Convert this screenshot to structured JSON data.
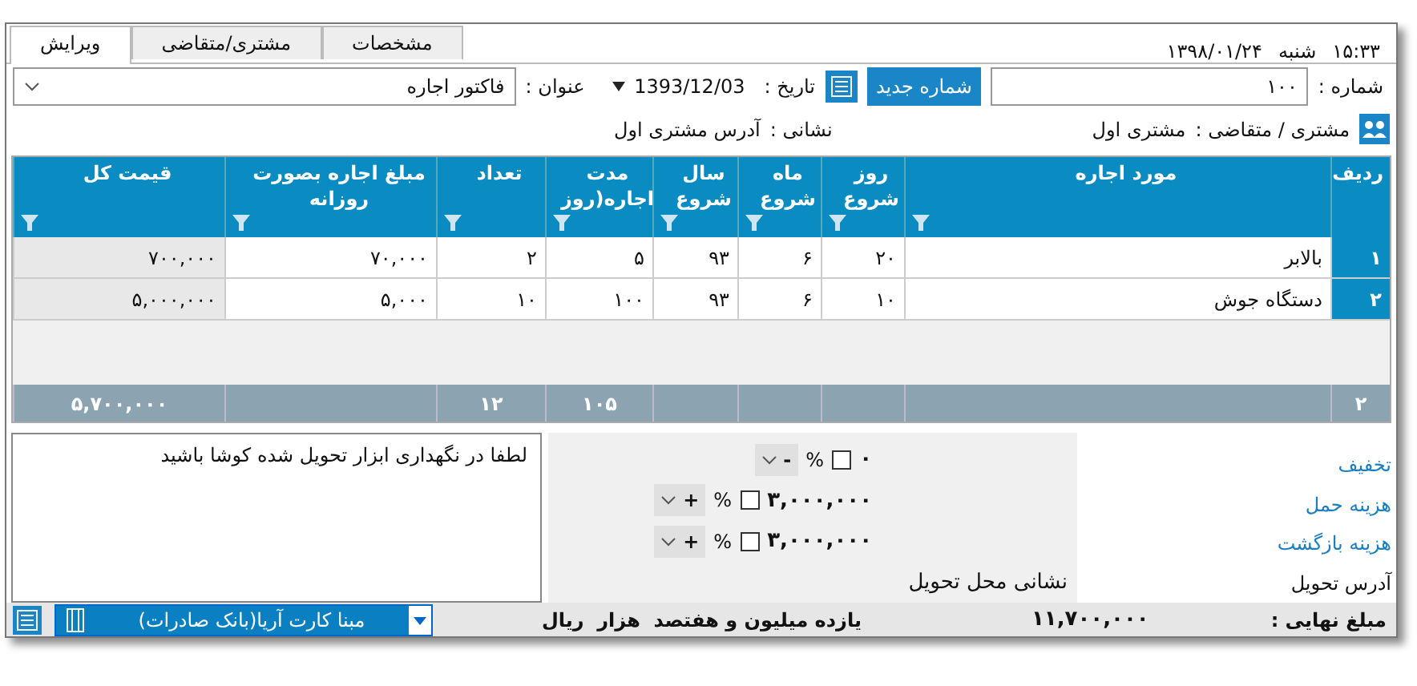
{
  "status": {
    "time": "۱۵:۳۳",
    "day": "شنبه",
    "date": "۱۳۹۸/۰۱/۲۴"
  },
  "tabs": [
    {
      "label": "مشخصات",
      "selected": false
    },
    {
      "label": "مشتری/متقاضی",
      "selected": false
    },
    {
      "label": "ویرایش",
      "selected": true
    }
  ],
  "number_field": {
    "label": "شماره :",
    "value": "۱۰۰"
  },
  "new_number_button": "شماره جدید",
  "date_field": {
    "label": "تاریخ :",
    "value": "1393/12/03"
  },
  "title_field": {
    "label": "عنوان :",
    "value": "فاکتور اجاره"
  },
  "customer": {
    "label": "مشتری / متقاضی :",
    "value": "مشتری اول"
  },
  "address": {
    "label": "نشانی :",
    "value": "آدرس مشتری اول"
  },
  "table": {
    "columns": [
      {
        "label": "ردیف"
      },
      {
        "label": "مورد اجاره"
      },
      {
        "label": "روز شروع"
      },
      {
        "label": "ماه شروع"
      },
      {
        "label": "سال شروع"
      },
      {
        "label": "مدت اجاره(روز"
      },
      {
        "label": "تعداد"
      },
      {
        "label": "مبلغ اجاره بصورت روزانه"
      },
      {
        "label": "قیمت کل"
      }
    ],
    "rows": [
      [
        "۱",
        "بالابر",
        "۲۰",
        "۶",
        "۹۳",
        "۵",
        "۲",
        "۷۰,۰۰۰",
        "۷۰۰,۰۰۰"
      ],
      [
        "۲",
        "دستگاه جوش",
        "۱۰",
        "۶",
        "۹۳",
        "۱۰۰",
        "۱۰",
        "۵,۰۰۰",
        "۵,۰۰۰,۰۰۰"
      ]
    ],
    "totals": {
      "count": "۲",
      "duration": "۱۰۵",
      "quantity": "۱۲",
      "total": "۵,۷۰۰,۰۰۰"
    }
  },
  "adjustments": [
    {
      "label": "تخفیف",
      "value": "۰",
      "percent": "%",
      "checked": false,
      "sign": "-"
    },
    {
      "label": "هزینه حمل",
      "value": "۳,۰۰۰,۰۰۰",
      "percent": "%",
      "checked": false,
      "sign": "+"
    },
    {
      "label": "هزینه بازگشت",
      "value": "۳,۰۰۰,۰۰۰",
      "percent": "%",
      "checked": false,
      "sign": "+"
    }
  ],
  "delivery": {
    "label": "آدرس تحویل",
    "value": "نشانی محل تحویل"
  },
  "notes": "لطفا در نگهداری ابزار تحویل شده کوشا باشید",
  "footer": {
    "label": "مبلغ نهایی :",
    "amount": "۱۱,۷۰۰,۰۰۰",
    "words": "یازده میلیون و هفتصد  هزار  ریال",
    "payment": "مبنا کارت آریا(بانک صادرات)"
  }
}
